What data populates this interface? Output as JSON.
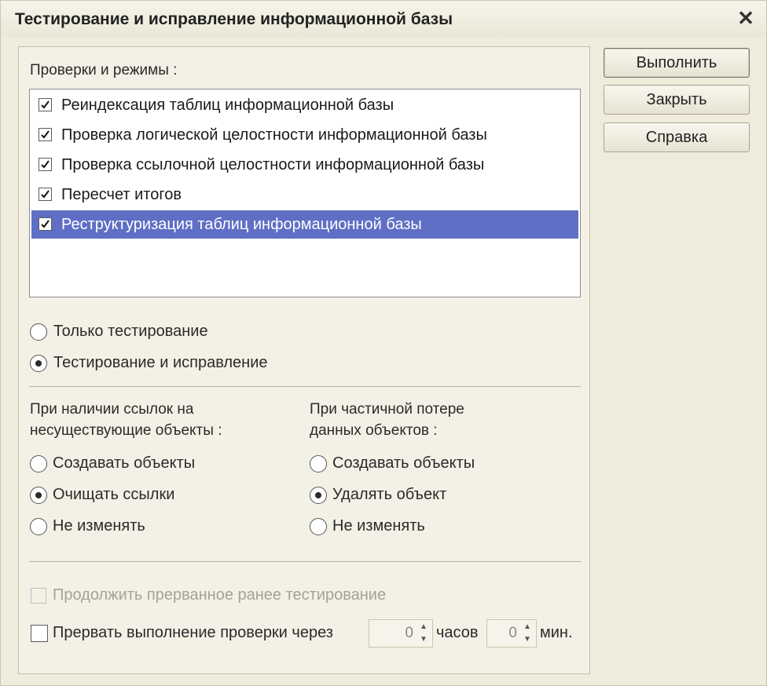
{
  "window": {
    "title": "Тестирование и исправление информационной базы",
    "close_glyph": "✕"
  },
  "buttons": {
    "run": "Выполнить",
    "close": "Закрыть",
    "help": "Справка"
  },
  "checks": {
    "label": "Проверки и режимы :",
    "items": [
      {
        "label": "Реиндексация таблиц информационной базы",
        "checked": true
      },
      {
        "label": "Проверка логической целостности информационной базы",
        "checked": true
      },
      {
        "label": "Проверка ссылочной целостности информационной базы",
        "checked": true
      },
      {
        "label": "Пересчет итогов",
        "checked": true
      },
      {
        "label": "Реструктуризация таблиц информационной базы",
        "checked": true,
        "selected": true
      }
    ]
  },
  "mode": {
    "options": [
      {
        "label": "Только тестирование",
        "selected": false
      },
      {
        "label": "Тестирование и исправление",
        "selected": true
      }
    ]
  },
  "missing_refs": {
    "label_line1": "При наличии ссылок на",
    "label_line2": "несуществующие объекты :",
    "options": [
      {
        "label": "Создавать объекты",
        "selected": false
      },
      {
        "label": "Очищать ссылки",
        "selected": true
      },
      {
        "label": "Не изменять",
        "selected": false
      }
    ]
  },
  "partial_loss": {
    "label_line1": "При частичной потере",
    "label_line2": "данных объектов :",
    "options": [
      {
        "label": "Создавать объекты",
        "selected": false
      },
      {
        "label": "Удалять объект",
        "selected": true
      },
      {
        "label": "Не изменять",
        "selected": false
      }
    ]
  },
  "continue_testing": {
    "label": "Продолжить прерванное ранее тестирование",
    "checked": false,
    "disabled": true
  },
  "interrupt": {
    "label": "Прервать выполнение проверки через",
    "checked": false,
    "hours_value": "0",
    "hours_label": "часов",
    "minutes_value": "0",
    "minutes_label": "мин."
  },
  "colors": {
    "selection": "#5f6fc5",
    "background": "#efecdc"
  }
}
